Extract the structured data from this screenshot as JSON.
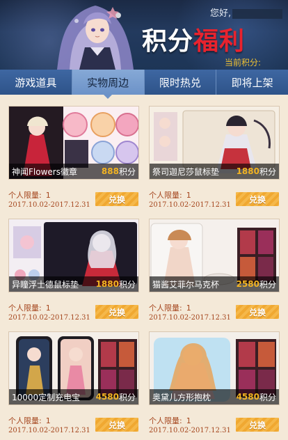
{
  "header": {
    "greeting": "您好,",
    "title_part1": "积分",
    "title_part2": "福利",
    "points_label": "当前积分:"
  },
  "tabs": [
    {
      "label": "游戏道具",
      "active": false
    },
    {
      "label": "实物周边",
      "active": true
    },
    {
      "label": "限时热兑",
      "active": false
    },
    {
      "label": "即将上架",
      "active": false
    }
  ],
  "products": [
    {
      "name": "神闻Flowers徽章",
      "points": "888",
      "points_unit": "积分",
      "limit_label": "个人限量:",
      "limit": "1",
      "date": "2017.10.02-2017.12.31",
      "button": "兑换"
    },
    {
      "name": "祭司迦尼莎鼠标垫",
      "points": "1880",
      "points_unit": "积分",
      "limit_label": "个人限量:",
      "limit": "1",
      "date": "2017.10.02-2017.12.31",
      "button": "兑换"
    },
    {
      "name": "异瞳浮士德鼠标垫",
      "points": "1880",
      "points_unit": "积分",
      "limit_label": "个人限量:",
      "limit": "1",
      "date": "2017.10.02-2017.12.31",
      "button": "兑换"
    },
    {
      "name": "猫酱艾菲尔马克杯",
      "points": "2580",
      "points_unit": "积分",
      "limit_label": "个人限量:",
      "limit": "1",
      "date": "2017.10.02-2017.12.31",
      "button": "兑换"
    },
    {
      "name": "10000定制充电宝",
      "points": "4580",
      "points_unit": "积分",
      "limit_label": "个人限量:",
      "limit": "1",
      "date": "2017.10.02-2017.12.31",
      "button": "兑换"
    },
    {
      "name": "奥黛儿方形抱枕",
      "points": "4580",
      "points_unit": "积分",
      "limit_label": "个人限量:",
      "limit": "1",
      "date": "2017.10.02-2017.12.31",
      "button": "兑换"
    }
  ],
  "colors": {
    "accent_red": "#e8232e",
    "points_gold": "#f2b322",
    "tab_bar": "#2e5389",
    "button": "#f0a831",
    "text_brown": "#a5461e"
  }
}
